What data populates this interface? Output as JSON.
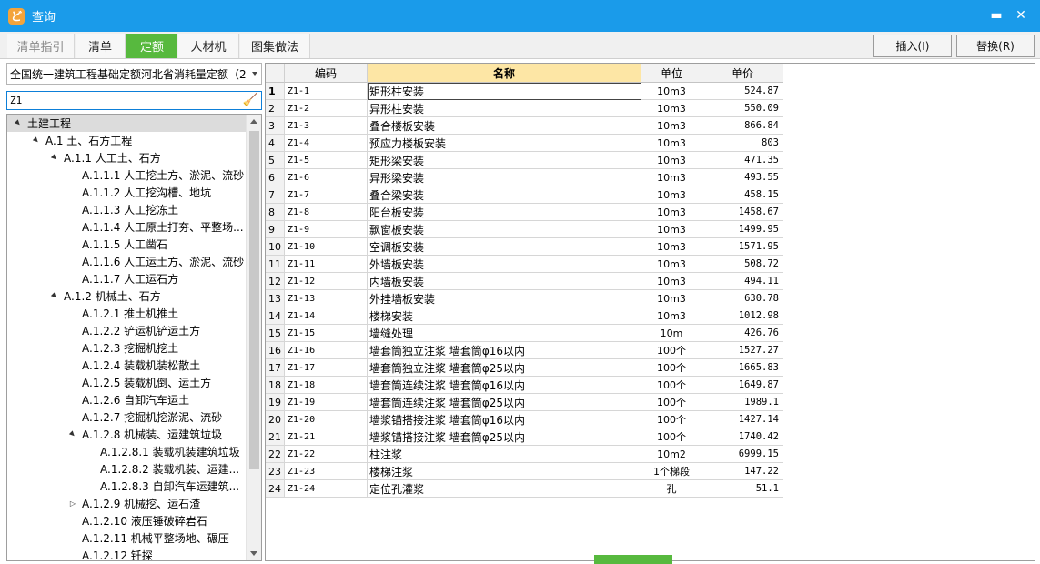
{
  "window": {
    "title": "查询",
    "minimize": "▬",
    "close": "✕"
  },
  "tabs": [
    {
      "label": "清单指引",
      "state": "disabled"
    },
    {
      "label": "清单",
      "state": "normal"
    },
    {
      "label": "定额",
      "state": "active"
    },
    {
      "label": "人材机",
      "state": "normal"
    },
    {
      "label": "图集做法",
      "state": "normal"
    }
  ],
  "actions": {
    "insert": "插入(I)",
    "replace": "替换(R)"
  },
  "quota_library": "全国统一建筑工程基础定额河北省消耗量定额（2",
  "search": {
    "value": "Z1"
  },
  "tree": [
    {
      "label": "土建工程",
      "level": 0,
      "arrow": "▲",
      "selected": true
    },
    {
      "label": "A.1 土、石方工程",
      "level": 1,
      "arrow": "▲"
    },
    {
      "label": "A.1.1 人工土、石方",
      "level": 2,
      "arrow": "▲"
    },
    {
      "label": "A.1.1.1 人工挖土方、淤泥、流砂",
      "level": 3,
      "arrow": ""
    },
    {
      "label": "A.1.1.2 人工挖沟槽、地坑",
      "level": 3,
      "arrow": ""
    },
    {
      "label": "A.1.1.3 人工挖冻土",
      "level": 3,
      "arrow": ""
    },
    {
      "label": "A.1.1.4 人工原土打夯、平整场...",
      "level": 3,
      "arrow": ""
    },
    {
      "label": "A.1.1.5 人工凿石",
      "level": 3,
      "arrow": ""
    },
    {
      "label": "A.1.1.6 人工运土方、淤泥、流砂",
      "level": 3,
      "arrow": ""
    },
    {
      "label": "A.1.1.7 人工运石方",
      "level": 3,
      "arrow": ""
    },
    {
      "label": "A.1.2 机械土、石方",
      "level": 2,
      "arrow": "▲"
    },
    {
      "label": "A.1.2.1 推土机推土",
      "level": 3,
      "arrow": ""
    },
    {
      "label": "A.1.2.2 铲运机铲运土方",
      "level": 3,
      "arrow": ""
    },
    {
      "label": "A.1.2.3 挖掘机挖土",
      "level": 3,
      "arrow": ""
    },
    {
      "label": "A.1.2.4 装载机装松散土",
      "level": 3,
      "arrow": ""
    },
    {
      "label": "A.1.2.5 装载机倒、运土方",
      "level": 3,
      "arrow": ""
    },
    {
      "label": "A.1.2.6 自卸汽车运土",
      "level": 3,
      "arrow": ""
    },
    {
      "label": "A.1.2.7 挖掘机挖淤泥、流砂",
      "level": 3,
      "arrow": ""
    },
    {
      "label": "A.1.2.8 机械装、运建筑垃圾",
      "level": 3,
      "arrow": "▲"
    },
    {
      "label": "A.1.2.8.1 装载机装建筑垃圾",
      "level": 4,
      "arrow": ""
    },
    {
      "label": "A.1.2.8.2 装载机装、运建...",
      "level": 4,
      "arrow": ""
    },
    {
      "label": "A.1.2.8.3 自卸汽车运建筑...",
      "level": 4,
      "arrow": ""
    },
    {
      "label": "A.1.2.9 机械挖、运石渣",
      "level": 3,
      "arrow": "▷"
    },
    {
      "label": "A.1.2.10 液压锤破碎岩石",
      "level": 3,
      "arrow": ""
    },
    {
      "label": "A.1.2.11 机械平整场地、碾压",
      "level": 3,
      "arrow": ""
    },
    {
      "label": "A.1.2.12 钎探",
      "level": 3,
      "arrow": ""
    }
  ],
  "grid": {
    "headers": {
      "rownum": "",
      "code": "编码",
      "name": "名称",
      "unit": "单位",
      "price": "单价"
    },
    "rows": [
      {
        "n": "1",
        "code": "Z1-1",
        "name": "矩形柱安装",
        "unit": "10m3",
        "price": "524.87"
      },
      {
        "n": "2",
        "code": "Z1-2",
        "name": "异形柱安装",
        "unit": "10m3",
        "price": "550.09"
      },
      {
        "n": "3",
        "code": "Z1-3",
        "name": "叠合楼板安装",
        "unit": "10m3",
        "price": "866.84"
      },
      {
        "n": "4",
        "code": "Z1-4",
        "name": "预应力楼板安装",
        "unit": "10m3",
        "price": "803"
      },
      {
        "n": "5",
        "code": "Z1-5",
        "name": "矩形梁安装",
        "unit": "10m3",
        "price": "471.35"
      },
      {
        "n": "6",
        "code": "Z1-6",
        "name": "异形梁安装",
        "unit": "10m3",
        "price": "493.55"
      },
      {
        "n": "7",
        "code": "Z1-7",
        "name": "叠合梁安装",
        "unit": "10m3",
        "price": "458.15"
      },
      {
        "n": "8",
        "code": "Z1-8",
        "name": "阳台板安装",
        "unit": "10m3",
        "price": "1458.67"
      },
      {
        "n": "9",
        "code": "Z1-9",
        "name": "飘窗板安装",
        "unit": "10m3",
        "price": "1499.95"
      },
      {
        "n": "10",
        "code": "Z1-10",
        "name": "空调板安装",
        "unit": "10m3",
        "price": "1571.95"
      },
      {
        "n": "11",
        "code": "Z1-11",
        "name": "外墙板安装",
        "unit": "10m3",
        "price": "508.72"
      },
      {
        "n": "12",
        "code": "Z1-12",
        "name": "内墙板安装",
        "unit": "10m3",
        "price": "494.11"
      },
      {
        "n": "13",
        "code": "Z1-13",
        "name": "外挂墙板安装",
        "unit": "10m3",
        "price": "630.78"
      },
      {
        "n": "14",
        "code": "Z1-14",
        "name": "楼梯安装",
        "unit": "10m3",
        "price": "1012.98"
      },
      {
        "n": "15",
        "code": "Z1-15",
        "name": "墙缝处理",
        "unit": "10m",
        "price": "426.76"
      },
      {
        "n": "16",
        "code": "Z1-16",
        "name": "墙套筒独立注浆 墙套筒φ16以内",
        "unit": "100个",
        "price": "1527.27"
      },
      {
        "n": "17",
        "code": "Z1-17",
        "name": "墙套筒独立注浆 墙套筒φ25以内",
        "unit": "100个",
        "price": "1665.83"
      },
      {
        "n": "18",
        "code": "Z1-18",
        "name": "墙套筒连续注浆 墙套筒φ16以内",
        "unit": "100个",
        "price": "1649.87"
      },
      {
        "n": "19",
        "code": "Z1-19",
        "name": "墙套筒连续注浆 墙套筒φ25以内",
        "unit": "100个",
        "price": "1989.1"
      },
      {
        "n": "20",
        "code": "Z1-20",
        "name": "墙浆锚搭接注浆 墙套筒φ16以内",
        "unit": "100个",
        "price": "1427.14"
      },
      {
        "n": "21",
        "code": "Z1-21",
        "name": "墙浆锚搭接注浆 墙套筒φ25以内",
        "unit": "100个",
        "price": "1740.42"
      },
      {
        "n": "22",
        "code": "Z1-22",
        "name": "柱注浆",
        "unit": "10m2",
        "price": "6999.15"
      },
      {
        "n": "23",
        "code": "Z1-23",
        "name": "楼梯注浆",
        "unit": "1个梯段",
        "price": "147.22"
      },
      {
        "n": "24",
        "code": "Z1-24",
        "name": "定位孔灌浆",
        "unit": "孔",
        "price": "51.1"
      }
    ]
  },
  "colors": {
    "titlebar": "#1a9bea",
    "active_tab": "#57b93e",
    "sorted_header": "#fde6a5",
    "search_border": "#0d7fd8"
  }
}
